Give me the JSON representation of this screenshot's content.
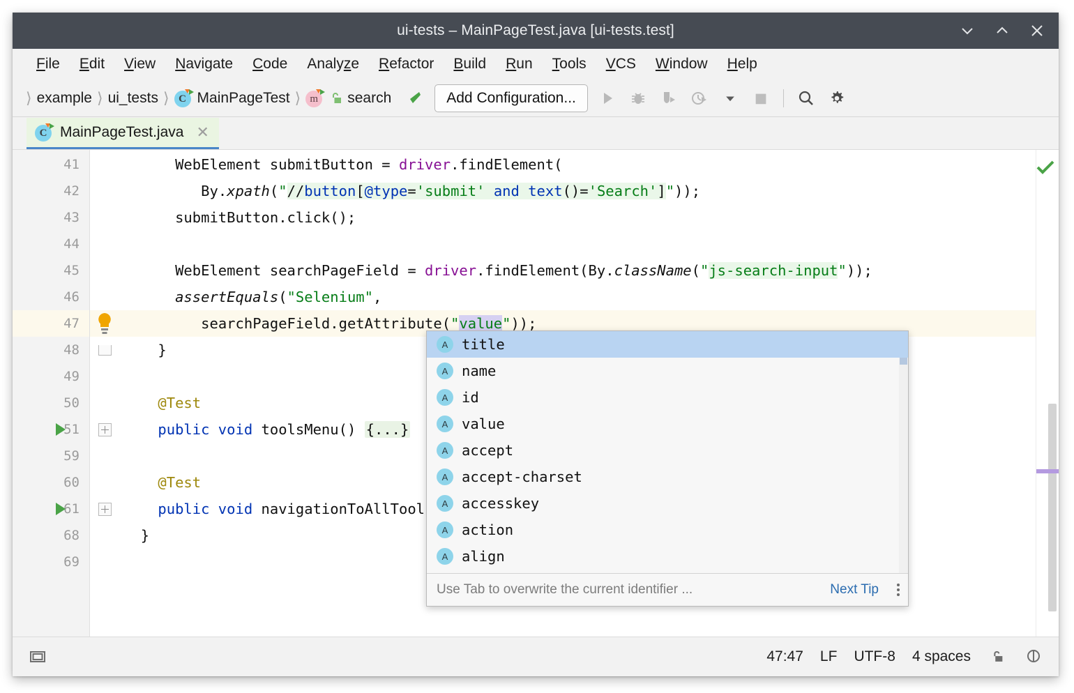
{
  "window": {
    "title": "ui-tests – MainPageTest.java [ui-tests.test]",
    "controls": [
      {
        "name": "minimize-button",
        "icon": "chevron-down-icon"
      },
      {
        "name": "maximize-button",
        "icon": "chevron-up-icon"
      },
      {
        "name": "close-button",
        "icon": "close-icon"
      }
    ]
  },
  "menubar": {
    "items": [
      {
        "label": "File",
        "mnemonic": "F"
      },
      {
        "label": "Edit",
        "mnemonic": "E"
      },
      {
        "label": "View",
        "mnemonic": "V"
      },
      {
        "label": "Navigate",
        "mnemonic": "N"
      },
      {
        "label": "Code",
        "mnemonic": "C"
      },
      {
        "label": "Analyze",
        "mnemonic": "z"
      },
      {
        "label": "Refactor",
        "mnemonic": "R"
      },
      {
        "label": "Build",
        "mnemonic": "B"
      },
      {
        "label": "Run",
        "mnemonic": "R"
      },
      {
        "label": "Tools",
        "mnemonic": "T"
      },
      {
        "label": "VCS",
        "mnemonic": "V"
      },
      {
        "label": "Window",
        "mnemonic": "W"
      },
      {
        "label": "Help",
        "mnemonic": "H"
      }
    ]
  },
  "navbar": {
    "breadcrumbs": [
      {
        "label": "example",
        "icon": null
      },
      {
        "label": "ui_tests",
        "icon": null
      },
      {
        "label": "MainPageTest",
        "icon": "class-icon"
      },
      {
        "label": "search",
        "icon": "method-icon"
      }
    ],
    "back_arrow_icon": "back-arrow-icon",
    "add_configuration_label": "Add Configuration...",
    "buttons": [
      {
        "name": "run-button",
        "icon": "run-icon"
      },
      {
        "name": "debug-button",
        "icon": "debug-icon"
      },
      {
        "name": "run-with-coverage-button",
        "icon": "coverage-icon"
      },
      {
        "name": "profile-button",
        "icon": "profile-icon"
      },
      {
        "name": "run-dropdown-button",
        "icon": "chevron-down-icon"
      },
      {
        "name": "stop-button",
        "icon": "stop-icon"
      },
      {
        "name": "search-everywhere-button",
        "icon": "search-icon"
      },
      {
        "name": "settings-button",
        "icon": "gear-icon"
      }
    ]
  },
  "tabs": [
    {
      "label": "MainPageTest.java",
      "icon": "class-icon",
      "close_icon": "close-icon",
      "active": true
    }
  ],
  "editor": {
    "lines": [
      {
        "num": "41",
        "indent": 6,
        "segments": [
          {
            "t": "WebElement submitButton = ",
            "c": "plain"
          },
          {
            "t": "driver",
            "c": "fld"
          },
          {
            "t": ".findElement(",
            "c": "plain"
          }
        ]
      },
      {
        "num": "42",
        "indent": 9,
        "segments": [
          {
            "t": "By.",
            "c": "plain"
          },
          {
            "t": "xpath",
            "c": "ital"
          },
          {
            "t": "(",
            "c": "plain"
          },
          {
            "t": "\"",
            "c": "str"
          },
          {
            "t": "//",
            "c": "xml-plain"
          },
          {
            "t": "button",
            "c": "xml-tag"
          },
          {
            "t": "[",
            "c": "xml-plain"
          },
          {
            "t": "@type",
            "c": "xml-tag"
          },
          {
            "t": "=",
            "c": "xml-plain"
          },
          {
            "t": "'submit'",
            "c": "xml-val"
          },
          {
            "t": " and ",
            "c": "xml-and"
          },
          {
            "t": "text",
            "c": "xml-tag"
          },
          {
            "t": "()=",
            "c": "xml-plain"
          },
          {
            "t": "'Search'",
            "c": "xml-val"
          },
          {
            "t": "]",
            "c": "xml-plain"
          },
          {
            "t": "\"",
            "c": "str"
          },
          {
            "t": "));",
            "c": "plain"
          }
        ]
      },
      {
        "num": "43",
        "indent": 6,
        "segments": [
          {
            "t": "submitButton.click();",
            "c": "plain"
          }
        ]
      },
      {
        "num": "44",
        "indent": 0,
        "segments": []
      },
      {
        "num": "45",
        "indent": 6,
        "segments": [
          {
            "t": "WebElement searchPageField = ",
            "c": "plain"
          },
          {
            "t": "driver",
            "c": "fld"
          },
          {
            "t": ".findElement(By.",
            "c": "plain"
          },
          {
            "t": "className",
            "c": "ital"
          },
          {
            "t": "(",
            "c": "plain"
          },
          {
            "t": "\"",
            "c": "str"
          },
          {
            "t": "js-search-input",
            "c": "xml-str"
          },
          {
            "t": "\"",
            "c": "str"
          },
          {
            "t": "));",
            "c": "plain"
          }
        ]
      },
      {
        "num": "46",
        "indent": 6,
        "segments": [
          {
            "t": "assertEquals",
            "c": "ital"
          },
          {
            "t": "(",
            "c": "plain"
          },
          {
            "t": "\"Selenium\"",
            "c": "str"
          },
          {
            "t": ",",
            "c": "plain"
          }
        ]
      },
      {
        "num": "47",
        "indent": 9,
        "current": true,
        "gutter_icon": "intention-bulb-icon",
        "segments": [
          {
            "t": "searchPageField.getAttribute(",
            "c": "plain"
          },
          {
            "t": "\"",
            "c": "str"
          },
          {
            "t": "value",
            "c": "selected-str"
          },
          {
            "t": "\"",
            "c": "str"
          },
          {
            "t": "));",
            "c": "plain"
          }
        ]
      },
      {
        "num": "48",
        "indent": 4,
        "fold_end": true,
        "segments": [
          {
            "t": "}",
            "c": "plain"
          }
        ]
      },
      {
        "num": "49",
        "indent": 0,
        "segments": []
      },
      {
        "num": "50",
        "indent": 4,
        "segments": [
          {
            "t": "@Test",
            "c": "ann"
          }
        ]
      },
      {
        "num": "51",
        "indent": 4,
        "run_marker": true,
        "fold_box": true,
        "segments": [
          {
            "t": "public",
            "c": "kw"
          },
          {
            "t": " ",
            "c": "plain"
          },
          {
            "t": "void",
            "c": "kw"
          },
          {
            "t": " ",
            "c": "plain"
          },
          {
            "t": "toolsMenu",
            "c": "method"
          },
          {
            "t": "() ",
            "c": "plain"
          },
          {
            "t": "{...}",
            "c": "fold"
          }
        ]
      },
      {
        "num": "59",
        "indent": 0,
        "segments": []
      },
      {
        "num": "60",
        "indent": 4,
        "segments": [
          {
            "t": "@Test",
            "c": "ann"
          }
        ]
      },
      {
        "num": "61",
        "indent": 4,
        "run_marker": true,
        "fold_box": true,
        "segments": [
          {
            "t": "public",
            "c": "kw"
          },
          {
            "t": " ",
            "c": "plain"
          },
          {
            "t": "void",
            "c": "kw"
          },
          {
            "t": " ",
            "c": "plain"
          },
          {
            "t": "navigationToAllTools",
            "c": "method"
          },
          {
            "t": "() ",
            "c": "plain"
          },
          {
            "t": "{..",
            "c": "fold"
          }
        ]
      },
      {
        "num": "68",
        "indent": 2,
        "segments": [
          {
            "t": "}",
            "c": "plain"
          }
        ]
      },
      {
        "num": "69",
        "indent": 0,
        "segments": []
      }
    ],
    "inspection_status_icon": "checkmark-ok-icon"
  },
  "completion_popup": {
    "items": [
      {
        "label": "title",
        "kind": "A",
        "selected": true
      },
      {
        "label": "name",
        "kind": "A",
        "selected": false
      },
      {
        "label": "id",
        "kind": "A",
        "selected": false
      },
      {
        "label": "value",
        "kind": "A",
        "selected": false
      },
      {
        "label": "accept",
        "kind": "A",
        "selected": false
      },
      {
        "label": "accept-charset",
        "kind": "A",
        "selected": false
      },
      {
        "label": "accesskey",
        "kind": "A",
        "selected": false
      },
      {
        "label": "action",
        "kind": "A",
        "selected": false
      },
      {
        "label": "align",
        "kind": "A",
        "selected": false
      },
      {
        "label": "--",
        "kind": "A",
        "selected": false
      }
    ],
    "footer_hint": "Use Tab to overwrite the current identifier ...",
    "next_tip_label": "Next Tip",
    "menu_icon": "kebab-menu-icon"
  },
  "statusbar": {
    "toggle_icon": "toggle-sidebar-icon",
    "position": "47:47",
    "line_separator": "LF",
    "encoding": "UTF-8",
    "indent": "4 spaces",
    "lock_icon": "unlocked-padlock-icon",
    "event_log_icon": "event-log-icon"
  },
  "colors": {
    "titlebar_bg": "#464b53",
    "accent_blue": "#4a86c8",
    "tab_bg": "#eaf5e2",
    "current_line": "#fdf9ec",
    "selection": "#d6d1f2",
    "popup_selected": "#b9d4f2",
    "keyword": "#0033b3",
    "string": "#067d17",
    "field": "#871094",
    "annotation": "#9e880d",
    "ok_check": "#4aa347",
    "marker_purple": "#b49ae0"
  }
}
